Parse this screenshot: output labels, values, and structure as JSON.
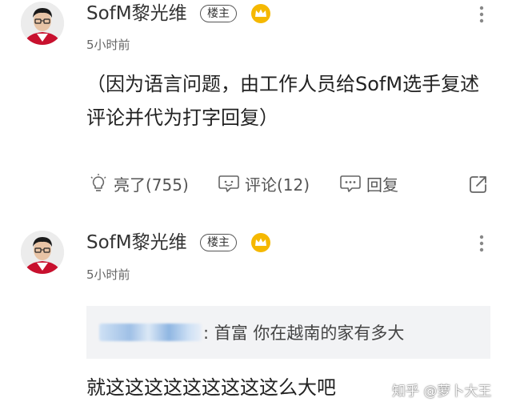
{
  "colors": {
    "text_primary": "#222222",
    "text_secondary": "#666666",
    "badge_gold": "#F5B800",
    "quote_bg": "#F2F3F5"
  },
  "posts": [
    {
      "username": "SofM黎光维",
      "badge": "楼主",
      "badge_icon": "crown-icon",
      "time": "5小时前",
      "content": "（因为语言问题，由工作人员给SofM选手复述评论并代为打字回复）",
      "actions": {
        "like_label": "亮了(755)",
        "comment_label": "评论(12)",
        "reply_label": "回复"
      }
    },
    {
      "username": "SofM黎光维",
      "badge": "楼主",
      "badge_icon": "crown-icon",
      "time": "5小时前",
      "quote": {
        "text": ": 首富 你在越南的家有多大"
      },
      "content": "就这这这这这这这这这么大吧"
    }
  ],
  "watermark": "知乎 @萝卜大王"
}
